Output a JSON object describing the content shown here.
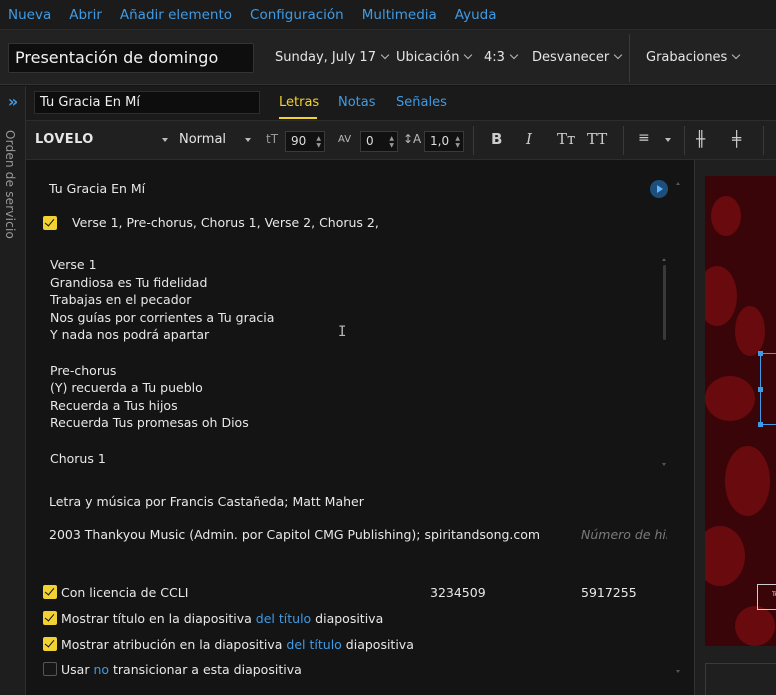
{
  "menu": [
    "Nueva",
    "Abrir",
    "Añadir elemento",
    "Configuración",
    "Multimedia",
    "Ayuda"
  ],
  "header": {
    "presentation_title": "Presentación de domingo",
    "date": "Sunday, July 17",
    "location": "Ubicación",
    "aspect": "4:3",
    "transition": "Desvanecer",
    "recordings": "Grabaciones"
  },
  "rail": {
    "toggle": "»",
    "label": "Orden de servicio"
  },
  "song": {
    "title_input": "Tu Gracia En Mí",
    "tabs": [
      "Letras",
      "Notas",
      "Señales"
    ]
  },
  "toolbar": {
    "font": "LOVELO",
    "weight": "Normal",
    "size_icon": "tT",
    "size": "90",
    "tracking_icon": "AV",
    "tracking": "0",
    "leading_icon": "↕A",
    "leading": "1,0",
    "bold": "B",
    "italic": "I",
    "small_caps": "Tт",
    "all_caps": "TT"
  },
  "editor": {
    "title": "Tu Gracia En Mí",
    "sequence": "Verse 1, Pre-chorus, Chorus 1, Verse 2, Chorus 2,",
    "lyrics": [
      "Verse 1",
      "Grandiosa es Tu fidelidad",
      "Trabajas en el pecador",
      "Nos guías por corrientes a Tu gracia",
      "Y nada nos podrá apartar",
      "",
      "Pre-chorus",
      "(Y) recuerda a Tu pueblo",
      "Recuerda a Tus hijos",
      "Recuerda Tus promesas oh Dios",
      "",
      "Chorus 1"
    ],
    "credits": "Letra y música por Francis Castañeda; Matt Maher",
    "copyright": "2003 Thankyou Music (Admin. por Capitol CMG Publishing); spiritandsong.com",
    "hymn_placeholder": "Número de himno",
    "ccli_label": "Con licencia de CCLI",
    "ccli_song_number": "3234509",
    "ccli_license": "5917255",
    "show_title": {
      "pre": "Mostrar título en la diapositiva",
      "link": "del título",
      "post": "diapositiva"
    },
    "show_attr": {
      "pre": "Mostrar atribución en la diapositiva",
      "link": "del título",
      "post": "diapositiva"
    },
    "no_transition": {
      "pre": "Usar",
      "link": "no",
      "post": "transicionar a esta diapositiva"
    }
  },
  "preview": {
    "mini_text": "Tu"
  },
  "colors": {
    "accent_blue": "#3f9be5",
    "accent_yellow": "#f2d133",
    "background": "#141414"
  }
}
